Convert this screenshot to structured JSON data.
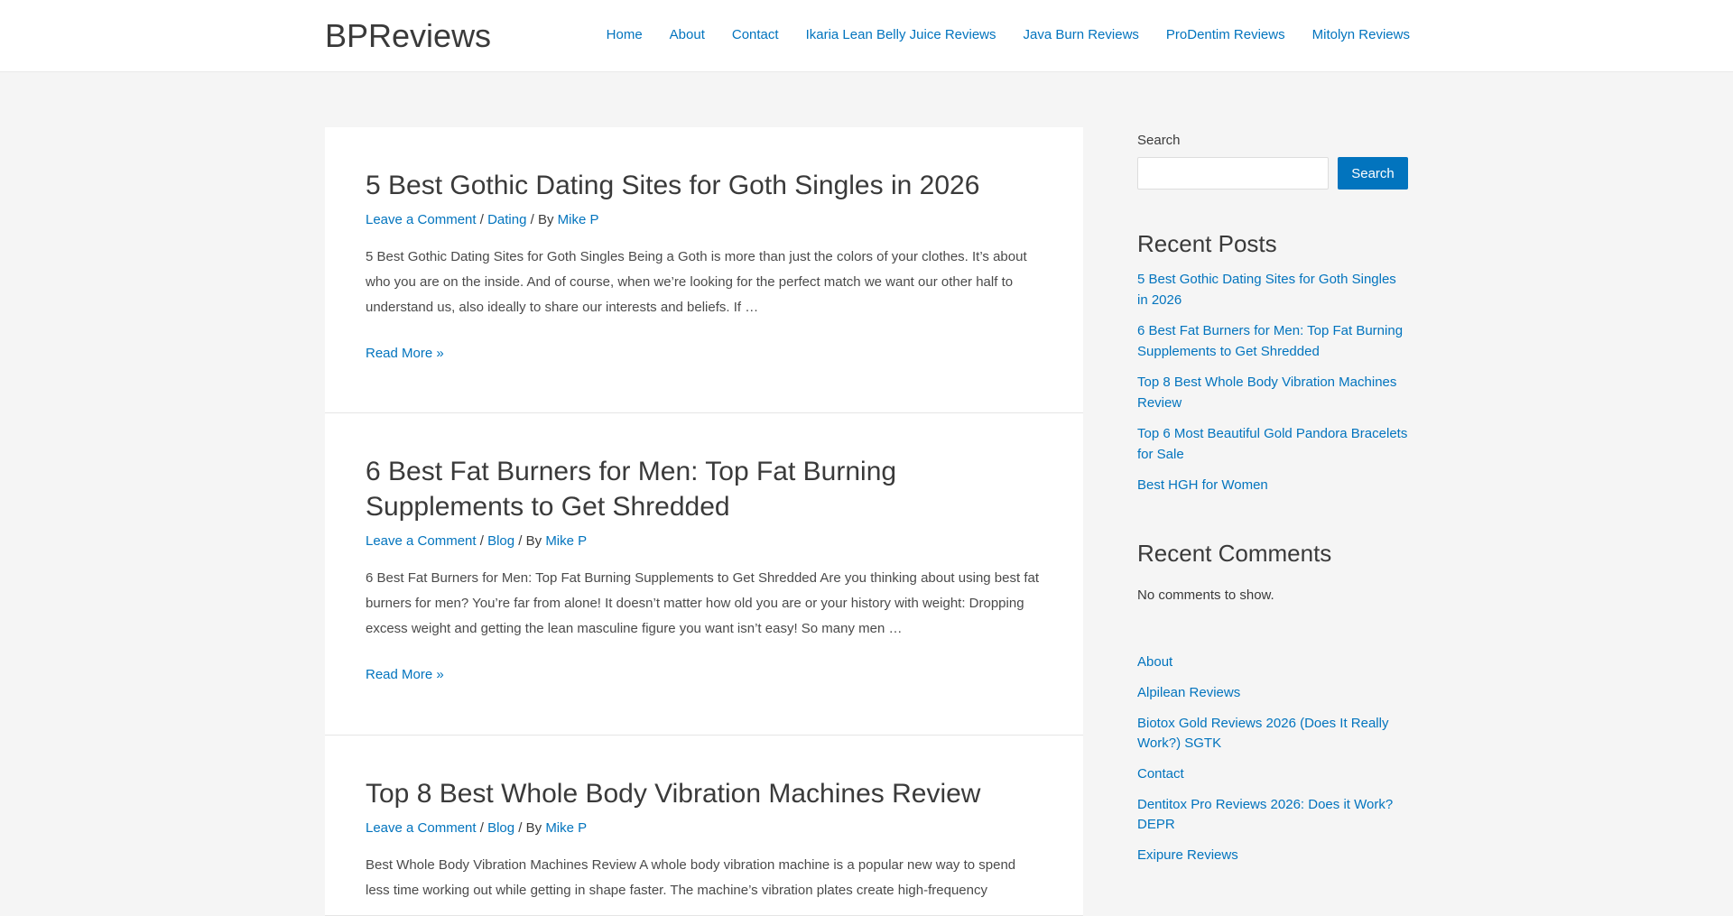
{
  "header": {
    "site_title": "BPReviews",
    "nav": [
      "Home",
      "About",
      "Contact",
      "Ikaria Lean Belly Juice Reviews",
      "Java Burn Reviews",
      "ProDentim Reviews",
      "Mitolyn Reviews"
    ]
  },
  "posts": [
    {
      "title": "5 Best Gothic Dating Sites for Goth Singles in 2026",
      "comment_link": "Leave a Comment",
      "category": "Dating",
      "by": "/ By",
      "author": "Mike P",
      "excerpt": "5 Best Gothic Dating Sites for Goth Singles Being a Goth is more than just the colors of your clothes. It’s about who you are on the inside. And of course, when we’re looking for the perfect match we want our other half to understand us, also ideally to share our interests and beliefs. If …",
      "read_more": "Read More »"
    },
    {
      "title": "6 Best Fat Burners for Men: Top Fat Burning Supplements to Get Shredded",
      "comment_link": "Leave a Comment",
      "category": "Blog",
      "by": "/ By",
      "author": "Mike P",
      "excerpt": "6 Best Fat Burners for Men: Top Fat Burning Supplements to Get Shredded Are you thinking about using best fat burners for men? You’re far from alone! It doesn’t matter how old you are or your history with weight: Dropping excess weight and getting the lean masculine figure you want isn’t easy! So many men …",
      "read_more": "Read More »"
    },
    {
      "title": "Top 8 Best Whole Body Vibration Machines Review",
      "comment_link": "Leave a Comment",
      "category": "Blog",
      "by": "/ By",
      "author": "Mike P",
      "excerpt": "Best Whole Body Vibration Machines Review A whole body vibration machine is a popular new way to spend less time working out while getting in shape faster. The machine’s vibration plates create high-frequency"
    }
  ],
  "sidebar": {
    "search_label": "Search",
    "search_button": "Search",
    "recent_posts_title": "Recent Posts",
    "recent_posts": [
      "5 Best Gothic Dating Sites for Goth Singles in 2026",
      "6 Best Fat Burners for Men: Top Fat Burning Supplements to Get Shredded",
      "Top 8 Best Whole Body Vibration Machines Review",
      "Top 6 Most Beautiful Gold Pandora Bracelets for Sale",
      "Best HGH for Women"
    ],
    "recent_comments_title": "Recent Comments",
    "no_comments": "No comments to show.",
    "pages": [
      "About",
      "Alpilean Reviews",
      "Biotox Gold Reviews 2026 (Does It Really Work?) SGTK",
      "Contact",
      "Dentitox Pro Reviews 2026: Does it Work? DEPR",
      "Exipure Reviews"
    ]
  }
}
